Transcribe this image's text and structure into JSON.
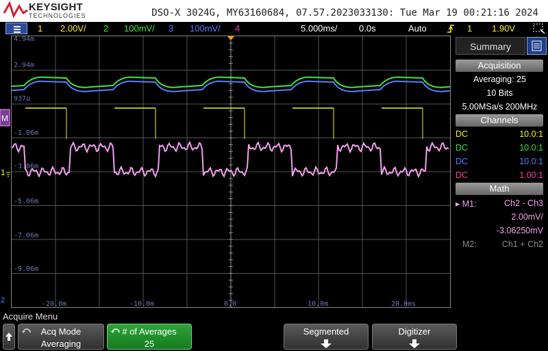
{
  "header": {
    "brand": "KEYSIGHT",
    "brand_sub": "TECHNOLOGIES",
    "model_line": "DSO-X 3024G, MY63160684, 07.57.2023033130: Tue Mar 19 00:21:16 2024"
  },
  "channel_bar": {
    "ch1_num": "1",
    "ch1_scale": "2.00V/",
    "ch2_num": "2",
    "ch2_scale": "100mV/",
    "ch3_num": "3",
    "ch3_scale": "100mV/",
    "ch4_num": "4",
    "timebase": "5.000ms/",
    "delay": "0.0s",
    "trigger_mode": "Auto",
    "trigger_src": "1",
    "trigger_level": "1.90V"
  },
  "graticule": {
    "y_labels": [
      "4.94m",
      "2.94m",
      "937u",
      "-1.06m",
      "-3.06m",
      "-5.06m",
      "-7.06m",
      "-9.06m"
    ],
    "x_labels": [
      "-20.0m",
      "-10.0m",
      "0.0",
      "10.0m",
      "20.0ms"
    ],
    "marker_ch1": "1",
    "marker_math": "M",
    "marker_ch2": "2"
  },
  "panel": {
    "tab_summary": "Summary",
    "acquisition_head": "Acquisition",
    "averaging": "Averaging: 25",
    "bits": "10 Bits",
    "sample_rate": "5.00MSa/s  200MHz",
    "channels_head": "Channels",
    "channels": [
      {
        "coupling": "DC",
        "probe": "10.0:1",
        "color": "#f5f51e"
      },
      {
        "coupling": "DC",
        "probe": "10.0:1",
        "color": "#3ee83e"
      },
      {
        "coupling": "DC",
        "probe": "10.0:1",
        "color": "#5a7dff"
      },
      {
        "coupling": "DC",
        "probe": "1.00:1",
        "color": "#ff3aa8"
      }
    ],
    "math_head": "Math",
    "m1_label": "M1:",
    "m1_expr": "Ch2 - Ch3",
    "m1_scale": "2.00mV/",
    "m1_offset": "-3.06250mV",
    "m2_label": "M2:",
    "m2_expr": "Ch1 + Ch2"
  },
  "softkeys": {
    "menu_title": "Acquire Menu",
    "acq_mode_label": "Acq Mode",
    "acq_mode_value": "Averaging",
    "averages_label": "# of Averages",
    "averages_value": "25",
    "segmented_label": "Segmented",
    "digitizer_label": "Digitizer"
  },
  "colors": {
    "ch1": "#f5f51e",
    "ch2": "#3ee83e",
    "ch3": "#5a7dff",
    "ch4": "#ff3aa8",
    "math": "#f4a0f0",
    "grid": "#555555"
  },
  "icons": {
    "menu": "hamburger-icon",
    "trigger": "trigger-edge-icon",
    "zoom": "zoom-box-icon",
    "panel_tab": "panel-list-icon",
    "back": "up-arrow-icon",
    "acq_mode": "rotate-knob-icon",
    "averages": "rotate-knob-icon",
    "segmented": "down-arrow-icon",
    "digitizer": "down-arrow-icon"
  }
}
